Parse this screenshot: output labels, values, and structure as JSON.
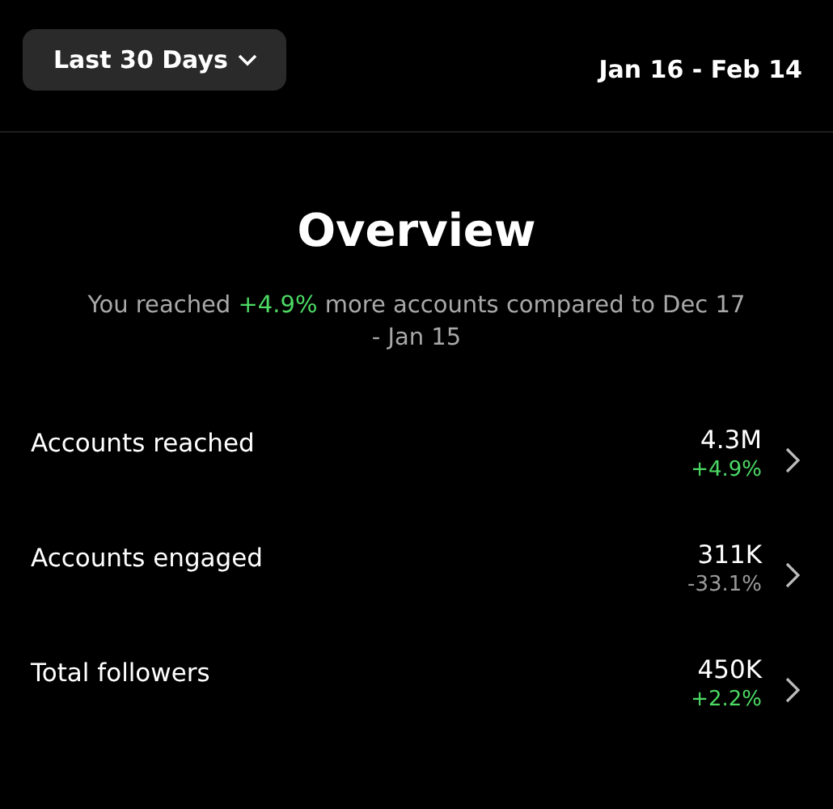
{
  "range_button": {
    "label": "Last 30 Days"
  },
  "date_range": "Jan 16 - Feb 14",
  "title": "Overview",
  "summary": {
    "before": "You reached ",
    "highlight": "+4.9%",
    "after": " more accounts compared to Dec 17 - Jan 15"
  },
  "metrics": [
    {
      "label": "Accounts reached",
      "value": "4.3M",
      "change": "+4.9%",
      "kind": "gain"
    },
    {
      "label": "Accounts engaged",
      "value": "311K",
      "change": "-33.1%",
      "kind": "loss"
    },
    {
      "label": "Total followers",
      "value": "450K",
      "change": "+2.2%",
      "kind": "gain"
    }
  ]
}
